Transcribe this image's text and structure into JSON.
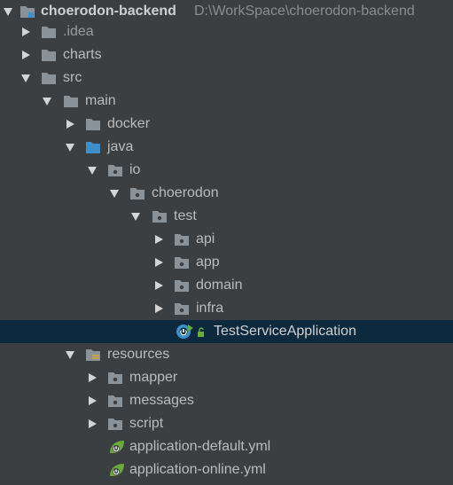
{
  "project": {
    "name": "choerodon-backend",
    "path": "D:\\WorkSpace\\choerodon-backend"
  },
  "nodes": {
    "idea": ".idea",
    "charts": "charts",
    "src": "src",
    "main": "main",
    "docker": "docker",
    "java": "java",
    "io": "io",
    "choerodon": "choerodon",
    "test": "test",
    "api": "api",
    "app": "app",
    "domain": "domain",
    "infra": "infra",
    "app_class": "TestServiceApplication",
    "resources": "resources",
    "mapper": "mapper",
    "messages": "messages",
    "script": "script",
    "yml_default": "application-default.yml",
    "yml_online": "application-online.yml"
  },
  "colors": {
    "background": "#3c3f41",
    "selection": "#0d293e",
    "folder": "#8a9299",
    "source_folder": "#3d8fc7",
    "spring_green": "#6aab3b"
  }
}
